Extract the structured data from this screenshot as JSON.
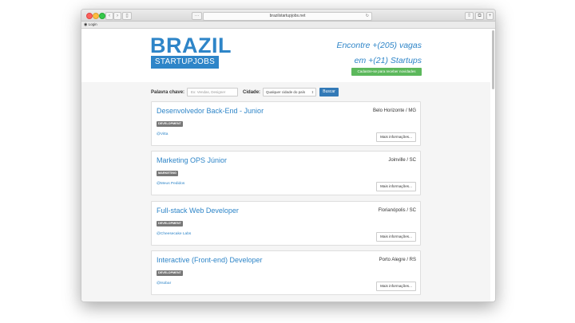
{
  "browser": {
    "url": "brazilstartupjobs.net",
    "bookmark": "Login"
  },
  "header": {
    "logo_top": "BRAZIL",
    "logo_bottom": "STARTUPJOBS",
    "tagline_line1": "Encontre +(205) vagas",
    "tagline_line2": "em +(21) Startups",
    "signup_label": "Cadastre-se para receber novidades"
  },
  "search": {
    "keyword_label": "Palavra chave:",
    "keyword_placeholder": "Ex: Vendas, Designer",
    "city_label": "Cidade:",
    "city_selected": "Qualquer cidade do país",
    "submit_label": "Buscar"
  },
  "jobs": [
    {
      "title": "Desenvolvedor Back-End - Junior",
      "location": "Belo Horizonte / MG",
      "tag": "DEVELOPMENT",
      "company": "@Vitta",
      "more_label": "Mais informações..."
    },
    {
      "title": "Marketing OPS Júnior",
      "location": "Joinville / SC",
      "tag": "MARKETING",
      "company": "@Meus Pedidos",
      "more_label": "Mais informações..."
    },
    {
      "title": "Full-stack Web Developer",
      "location": "Florianópolis / SC",
      "tag": "DEVELOPMENT",
      "company": "@Cheesecake Labs",
      "more_label": "Mais informações..."
    },
    {
      "title": "Interactive (Front-end) Developer",
      "location": "Porto Alegre / RS",
      "tag": "DEVELOPMENT",
      "company": "@Isobar",
      "more_label": "Mais informações..."
    }
  ],
  "colors": {
    "brand_blue": "#2e85c8",
    "signup_green": "#5cb85c",
    "search_button": "#337ab7",
    "tag_gray": "#777777"
  }
}
